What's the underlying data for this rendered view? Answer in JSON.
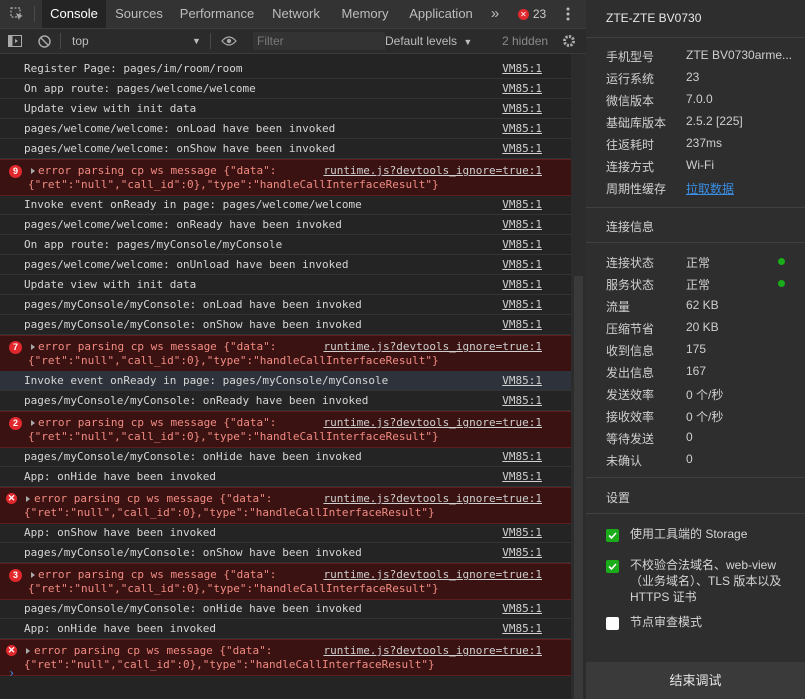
{
  "tabs": {
    "items": [
      "Console",
      "Sources",
      "Performance",
      "Network",
      "Memory",
      "Application"
    ],
    "more": "»",
    "error_count": "23"
  },
  "filterbar": {
    "context": "top",
    "filter_placeholder": "Filter",
    "levels": "Default levels",
    "hidden": "2 hidden"
  },
  "console": {
    "rows": [
      {
        "msg": "Register Page: pages/im/room/room",
        "src": "VM85:1"
      },
      {
        "msg": "On app route: pages/welcome/welcome",
        "src": "VM85:1"
      },
      {
        "msg": "Update view with init data",
        "src": "VM85:1"
      },
      {
        "msg": "pages/welcome/welcome: onLoad have been invoked",
        "src": "VM85:1"
      },
      {
        "msg": "pages/welcome/welcome: onShow have been invoked",
        "src": "VM85:1"
      },
      {
        "msg": "error parsing cp ws message {\"data\":",
        "msg2": "{\"ret\":\"null\",\"call_id\":0},\"type\":\"handleCallInterfaceResult\"}",
        "src": "runtime.js?devtools_ignore=true:1",
        "count": "9"
      },
      {
        "msg": "Invoke event onReady in page: pages/welcome/welcome",
        "src": "VM85:1"
      },
      {
        "msg": "pages/welcome/welcome: onReady have been invoked",
        "src": "VM85:1"
      },
      {
        "msg": "On app route: pages/myConsole/myConsole",
        "src": "VM85:1"
      },
      {
        "msg": "pages/welcome/welcome: onUnload have been invoked",
        "src": "VM85:1"
      },
      {
        "msg": "Update view with init data",
        "src": "VM85:1"
      },
      {
        "msg": "pages/myConsole/myConsole: onLoad have been invoked",
        "src": "VM85:1"
      },
      {
        "msg": "pages/myConsole/myConsole: onShow have been invoked",
        "src": "VM85:1"
      },
      {
        "msg": "error parsing cp ws message {\"data\":",
        "msg2": "{\"ret\":\"null\",\"call_id\":0},\"type\":\"handleCallInterfaceResult\"}",
        "src": "runtime.js?devtools_ignore=true:1",
        "count": "7"
      },
      {
        "msg": "Invoke event onReady in page: pages/myConsole/myConsole",
        "src": "VM85:1"
      },
      {
        "msg": "pages/myConsole/myConsole: onReady have been invoked",
        "src": "VM85:1"
      },
      {
        "msg": "error parsing cp ws message {\"data\":",
        "msg2": "{\"ret\":\"null\",\"call_id\":0},\"type\":\"handleCallInterfaceResult\"}",
        "src": "runtime.js?devtools_ignore=true:1",
        "count": "2"
      },
      {
        "msg": "pages/myConsole/myConsole: onHide have been invoked",
        "src": "VM85:1"
      },
      {
        "msg": "App: onHide have been invoked",
        "src": "VM85:1"
      },
      {
        "msg": "error parsing cp ws message {\"data\":",
        "msg2": "{\"ret\":\"null\",\"call_id\":0},\"type\":\"handleCallInterfaceResult\"}",
        "src": "runtime.js?devtools_ignore=true:1"
      },
      {
        "msg": "App: onShow have been invoked",
        "src": "VM85:1"
      },
      {
        "msg": "pages/myConsole/myConsole: onShow have been invoked",
        "src": "VM85:1"
      },
      {
        "msg": "error parsing cp ws message {\"data\":",
        "msg2": "{\"ret\":\"null\",\"call_id\":0},\"type\":\"handleCallInterfaceResult\"}",
        "src": "runtime.js?devtools_ignore=true:1",
        "count": "3"
      },
      {
        "msg": "pages/myConsole/myConsole: onHide have been invoked",
        "src": "VM85:1"
      },
      {
        "msg": "App: onHide have been invoked",
        "src": "VM85:1"
      },
      {
        "msg": "error parsing cp ws message {\"data\":",
        "msg2": "{\"ret\":\"null\",\"call_id\":0},\"type\":\"handleCallInterfaceResult\"}",
        "src": "runtime.js?devtools_ignore=true:1"
      }
    ]
  },
  "panel": {
    "title": "ZTE-ZTE BV0730",
    "device_info": [
      {
        "k": "手机型号",
        "v": "ZTE BV0730arme..."
      },
      {
        "k": "运行系统",
        "v": "23"
      },
      {
        "k": "微信版本",
        "v": "7.0.0"
      },
      {
        "k": "基础库版本",
        "v": "2.5.2 [225]"
      },
      {
        "k": "往返耗时",
        "v": "237ms"
      },
      {
        "k": "连接方式",
        "v": "Wi-Fi"
      },
      {
        "k": "周期性缓存",
        "v": "拉取数据"
      }
    ],
    "conn_title": "连接信息",
    "conn_info": [
      {
        "k": "连接状态",
        "v": "正常"
      },
      {
        "k": "服务状态",
        "v": "正常"
      },
      {
        "k": "流量",
        "v": "62 KB"
      },
      {
        "k": "压缩节省",
        "v": "20 KB"
      },
      {
        "k": "收到信息",
        "v": "175"
      },
      {
        "k": "发出信息",
        "v": "167"
      },
      {
        "k": "发送效率",
        "v": "0 个/秒"
      },
      {
        "k": "接收效率",
        "v": "0 个/秒"
      },
      {
        "k": "等待发送",
        "v": "0"
      },
      {
        "k": "未确认",
        "v": "0"
      }
    ],
    "settings_title": "设置",
    "settings": [
      {
        "label": "使用工具端的 Storage",
        "checked": true
      },
      {
        "label": "不校验合法域名、web-view（业务域名）、TLS 版本以及 HTTPS 证书",
        "checked": true
      },
      {
        "label": "节点审查模式",
        "checked": false
      }
    ],
    "end_button": "结束调试"
  },
  "colors": {
    "error_bg": "#3a1212",
    "badge": "#e0282d",
    "status_ok": "#1aad19",
    "link": "#3a8ee6"
  }
}
